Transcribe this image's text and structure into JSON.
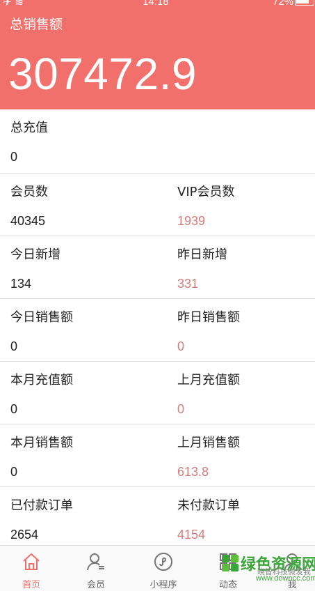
{
  "status_bar": {
    "time": "14:18",
    "battery": "72%"
  },
  "header": {
    "title": "总销售额",
    "value": "307472.9"
  },
  "rows": [
    {
      "left": {
        "label": "总充值",
        "value": "0"
      }
    },
    {
      "left": {
        "label": "会员数",
        "value": "40345"
      },
      "right": {
        "label": "VIP会员数",
        "value": "1939"
      }
    },
    {
      "left": {
        "label": "今日新增",
        "value": "134"
      },
      "right": {
        "label": "昨日新增",
        "value": "331"
      }
    },
    {
      "left": {
        "label": "今日销售额",
        "value": "0"
      },
      "right": {
        "label": "昨日销售额",
        "value": "0"
      }
    },
    {
      "left": {
        "label": "本月充值额",
        "value": "0"
      },
      "right": {
        "label": "上月充值额",
        "value": "0"
      }
    },
    {
      "left": {
        "label": "本月销售额",
        "value": "0"
      },
      "right": {
        "label": "上月销售额",
        "value": "613.8"
      }
    },
    {
      "left": {
        "label": "已付款订单",
        "value": "2654"
      },
      "right": {
        "label": "未付款订单",
        "value": "4154"
      }
    }
  ],
  "tabs": [
    {
      "label": "首页",
      "icon": "home-icon",
      "active": true
    },
    {
      "label": "会员",
      "icon": "member-icon"
    },
    {
      "label": "小程序",
      "icon": "miniprogram-icon"
    },
    {
      "label": "动态",
      "icon": "feed-icon"
    },
    {
      "label": "我",
      "icon": "profile-icon"
    }
  ],
  "watermark": {
    "text": "绿色资源网",
    "url": "www.downcc.com",
    "sub": "晓智科技微发我"
  },
  "colors": {
    "accent": "#f2706b",
    "value_pink": "#d27f7d"
  }
}
